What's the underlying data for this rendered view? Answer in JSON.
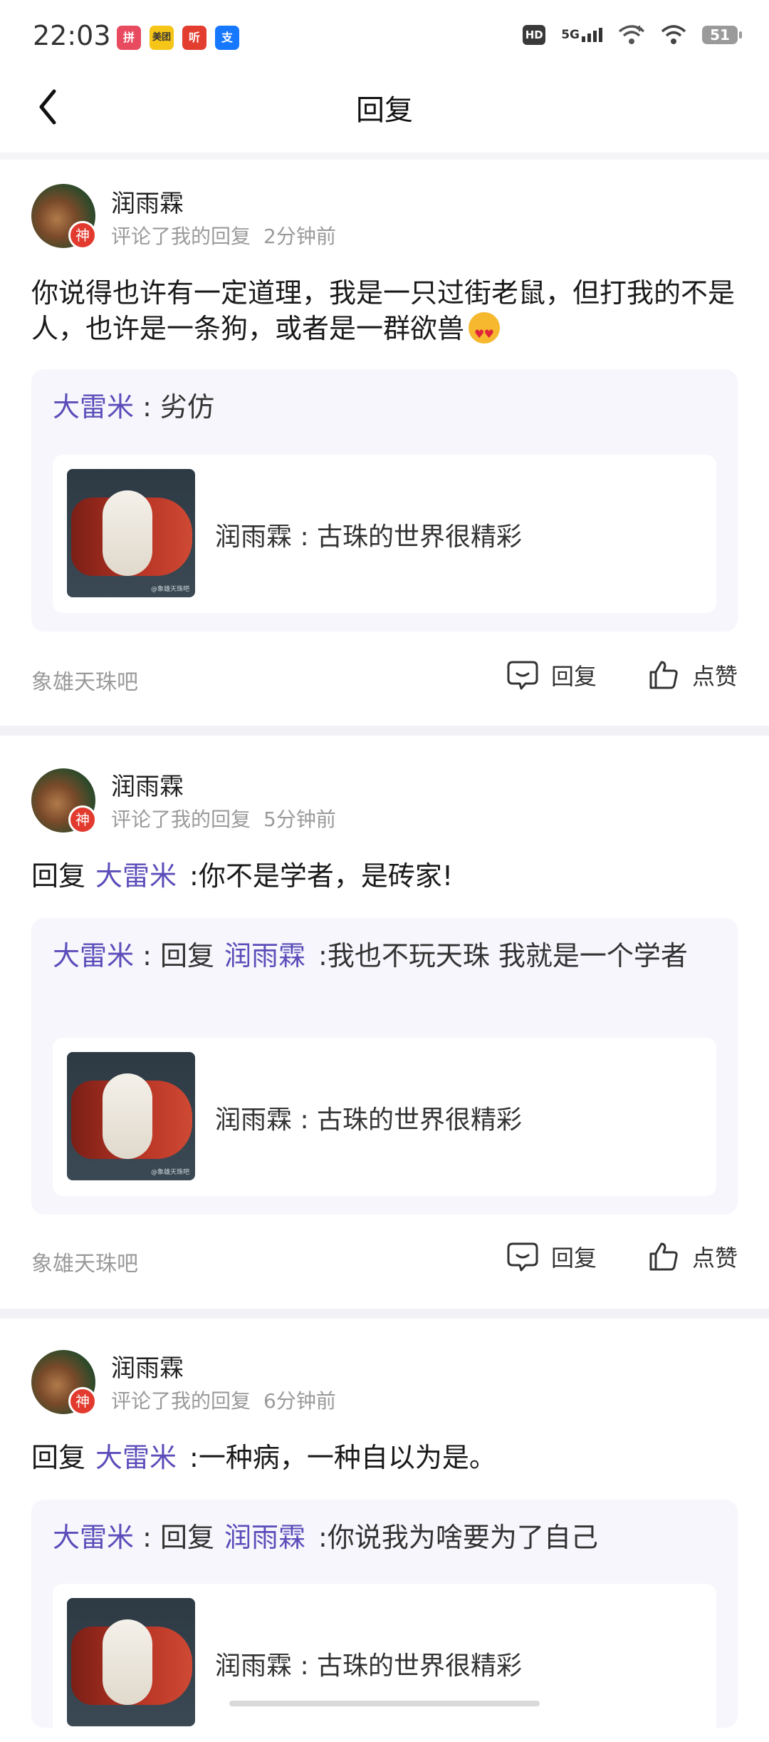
{
  "status_bar": {
    "time": "22:03",
    "apps": [
      {
        "icon": "pinduoduo-icon",
        "text": "拼",
        "color": "#e84a5f"
      },
      {
        "icon": "meituan-icon",
        "text": "美团",
        "color": "#f5c518"
      },
      {
        "icon": "ting-icon",
        "text": "听",
        "color": "#e33d2f"
      },
      {
        "icon": "alipay-icon",
        "text": "支",
        "color": "#1677ff"
      }
    ],
    "hd": "HD",
    "network": "5G",
    "battery": "51"
  },
  "header": {
    "title": "回复"
  },
  "cards": [
    {
      "username": "润雨霖",
      "badge": "神",
      "action": "评论了我的回复",
      "time": "2分钟前",
      "content_text": "你说得也许有一定道理，我是一只过街老鼠，但打我的不是人，也许是一条狗，或者是一群欲兽",
      "quote_name": "大雷米",
      "quote_sep": " : ",
      "quote_text": "劣仿",
      "inner_text": "润雨霖 : 古珠的世界很精彩",
      "thumb_wm": "@象雄天珠吧",
      "forum": "象雄天珠吧",
      "reply_label": "回复",
      "like_label": "点赞"
    },
    {
      "username": "润雨霖",
      "badge": "神",
      "action": "评论了我的回复",
      "time": "5分钟前",
      "content_prefix": "回复",
      "content_mention": "大雷米",
      "content_text": ":你不是学者，是砖家!",
      "quote_name": "大雷米",
      "quote_sep": " : ",
      "quote_prefix": "回复",
      "quote_mention": "润雨霖",
      "quote_text": ":我也不玩天珠 我就是一个学者",
      "inner_text": "润雨霖 : 古珠的世界很精彩",
      "thumb_wm": "@象雄天珠吧",
      "forum": "象雄天珠吧",
      "reply_label": "回复",
      "like_label": "点赞"
    },
    {
      "username": "润雨霖",
      "badge": "神",
      "action": "评论了我的回复",
      "time": "6分钟前",
      "content_prefix": "回复",
      "content_mention": "大雷米",
      "content_text": ":一种病，一种自以为是。",
      "quote_name": "大雷米",
      "quote_sep": " : ",
      "quote_prefix": "回复",
      "quote_mention": "润雨霖",
      "quote_text": ":你说我为啥要为了自己",
      "inner_text": "润雨霖 : 古珠的世界很精彩"
    }
  ]
}
